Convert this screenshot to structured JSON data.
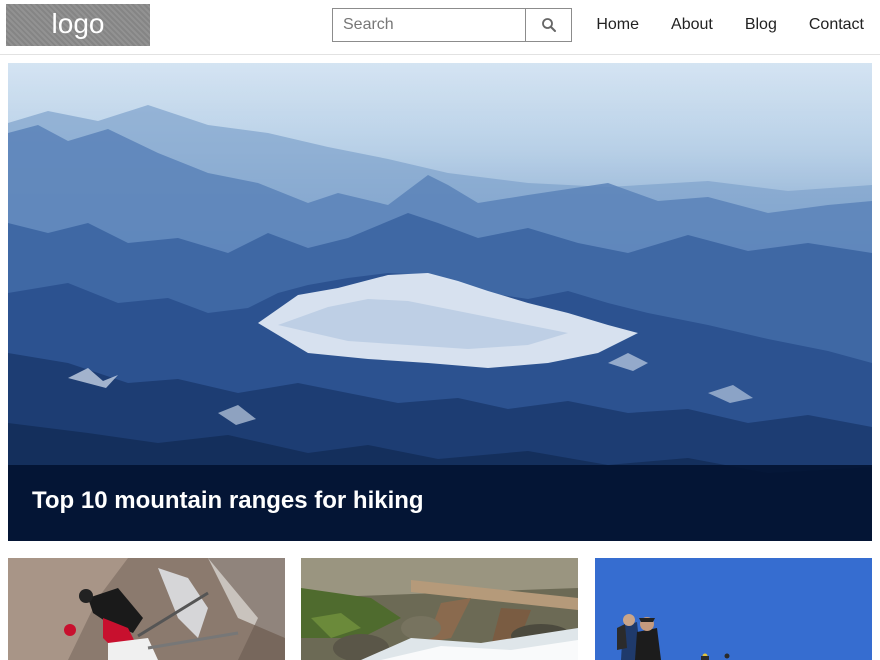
{
  "header": {
    "logo_text": "logo",
    "search": {
      "placeholder": "Search",
      "icon": "search-icon"
    },
    "nav": [
      "Home",
      "About",
      "Blog",
      "Contact"
    ]
  },
  "hero": {
    "title": "Top 10 mountain ranges for hiking"
  },
  "thumbnails": [
    {
      "subject": "ice-climber"
    },
    {
      "subject": "mountain-stream"
    },
    {
      "subject": "hikers-on-summit"
    }
  ],
  "colors": {
    "logo_bg": "#8a8a8a",
    "caption_bg": "#021230",
    "hero_sky": "#c8dcef",
    "hero_mountain": "#22467f"
  }
}
